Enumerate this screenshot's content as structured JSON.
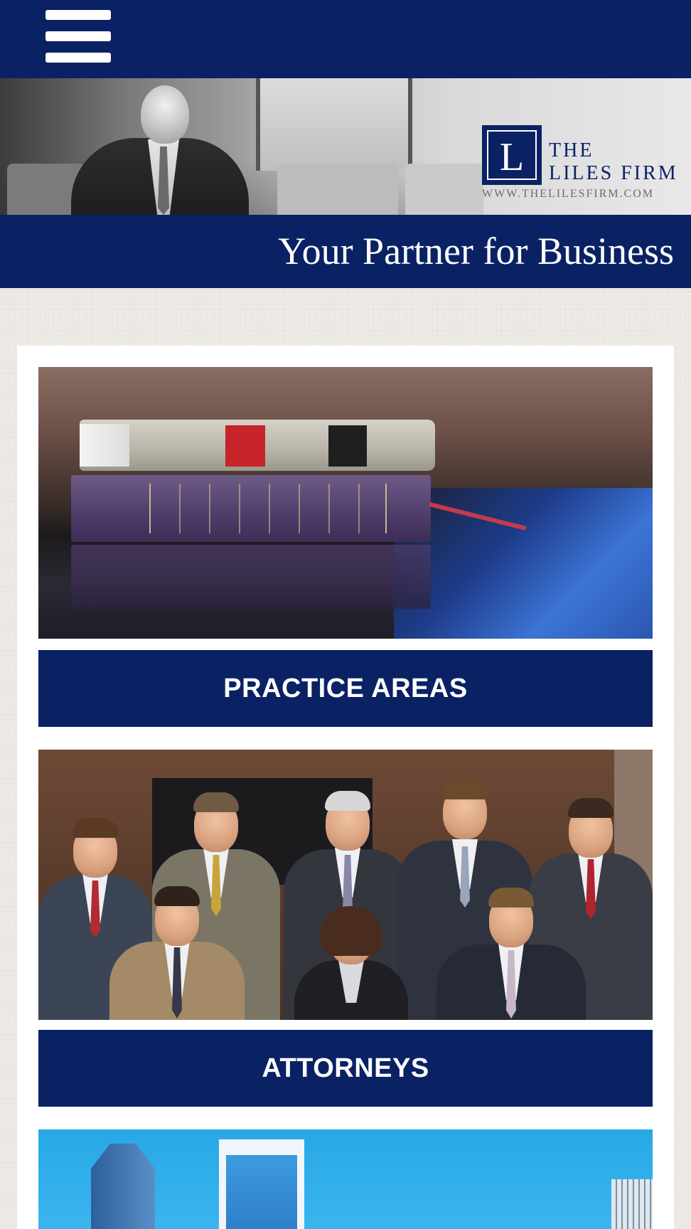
{
  "nav": {
    "menu_icon": "hamburger-menu-icon"
  },
  "hero": {
    "logo": {
      "initial": "L",
      "line1": "THE",
      "line2": "LILES FIRM",
      "url": "WWW.THELILESFIRM.COM"
    }
  },
  "tagline": "Your Partner for Business",
  "tiles": [
    {
      "image": "law-books-photo",
      "label": "PRACTICE AREAS"
    },
    {
      "image": "attorneys-group-photo",
      "label": "ATTORNEYS"
    },
    {
      "image": "city-skyline-photo",
      "label": ""
    }
  ],
  "colors": {
    "brand_navy": "#0a2264",
    "card_bg": "#ffffff",
    "page_bg": "#ece9e4"
  }
}
